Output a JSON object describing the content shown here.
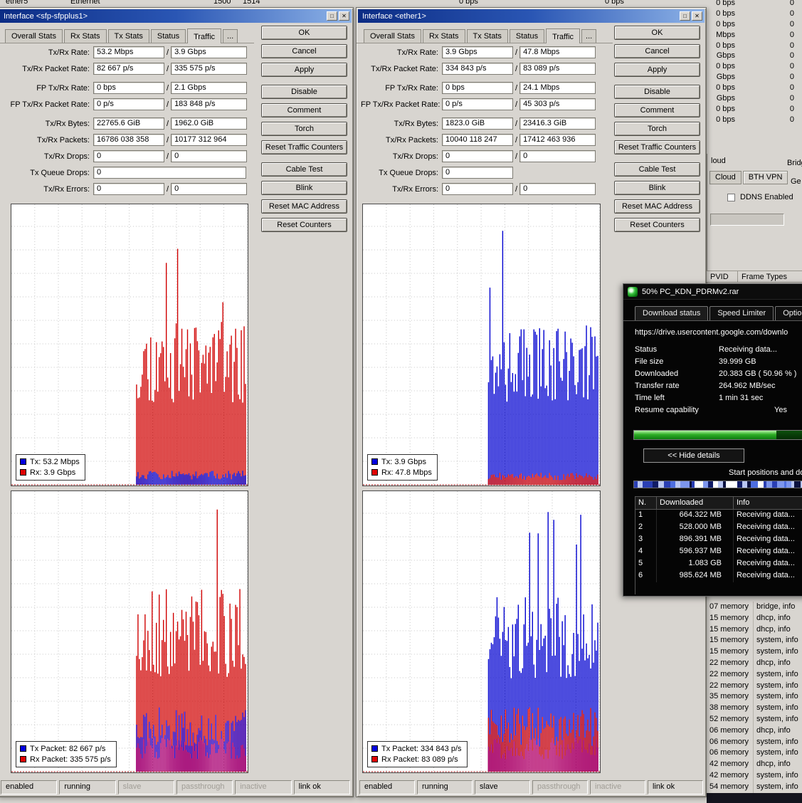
{
  "chrome": {
    "maximize_glyph": "□",
    "close_glyph": "✕"
  },
  "background": {
    "top_row": [
      "ether5",
      "Ethernet",
      "1500",
      "1514",
      "0 bps",
      "0 bps"
    ],
    "right_rates": [
      {
        "rate": "0 bps",
        "count": "0"
      },
      {
        "rate": "0 bps",
        "count": "0"
      },
      {
        "rate": "0 bps",
        "count": "0"
      },
      {
        "rate": "Mbps",
        "count": "0"
      },
      {
        "rate": "0 bps",
        "count": "0"
      },
      {
        "rate": "Gbps",
        "count": "0"
      },
      {
        "rate": "0 bps",
        "count": "0"
      },
      {
        "rate": "Gbps",
        "count": "0"
      },
      {
        "rate": "0 bps",
        "count": "0"
      },
      {
        "rate": "Gbps",
        "count": "0"
      },
      {
        "rate": "0 bps",
        "count": "0"
      },
      {
        "rate": "0 bps",
        "count": "0"
      }
    ],
    "cloud": {
      "title_fragment": "loud",
      "tabs": [
        {
          "label": "Cloud"
        },
        {
          "label": "BTH VPN",
          "active": true
        }
      ],
      "ddns_label": "DDNS Enabled",
      "bridge_fragment": "Bridg",
      "general_fragment": "Ge"
    },
    "port_headers": {
      "pvid": "PVID",
      "frame_types": "Frame Types"
    },
    "log_rows": [
      {
        "t": "07 memory",
        "m": "bridge, info"
      },
      {
        "t": "15 memory",
        "m": "dhcp, info"
      },
      {
        "t": "15 memory",
        "m": "dhcp, info"
      },
      {
        "t": "15 memory",
        "m": "system, info"
      },
      {
        "t": "15 memory",
        "m": "system, info"
      },
      {
        "t": "22 memory",
        "m": "dhcp, info"
      },
      {
        "t": "22 memory",
        "m": "system, info"
      },
      {
        "t": "22 memory",
        "m": "system, info"
      },
      {
        "t": "35 memory",
        "m": "system, info"
      },
      {
        "t": "38 memory",
        "m": "system, info"
      },
      {
        "t": "52 memory",
        "m": "system, info"
      },
      {
        "t": "06 memory",
        "m": "dhcp, info"
      },
      {
        "t": "06 memory",
        "m": "system, info"
      },
      {
        "t": "06 memory",
        "m": "system, info"
      },
      {
        "t": "42 memory",
        "m": "dhcp, info"
      },
      {
        "t": "42 memory",
        "m": "system, info"
      },
      {
        "t": "54 memory",
        "m": "system, info"
      }
    ]
  },
  "iface_left": {
    "title": "Interface <sfp-sfpplus1>",
    "tabs": [
      {
        "label": "Overall Stats"
      },
      {
        "label": "Rx Stats"
      },
      {
        "label": "Tx Stats"
      },
      {
        "label": "Status"
      },
      {
        "label": "Traffic",
        "active": true
      },
      {
        "label": "...",
        "more": true
      }
    ],
    "fields": [
      {
        "label": "Tx/Rx Rate:",
        "v1": "53.2 Mbps",
        "v2": "3.9 Gbps"
      },
      {
        "label": "Tx/Rx Packet Rate:",
        "v1": "82 667 p/s",
        "v2": "335 575 p/s"
      },
      {
        "label": "FP Tx/Rx Rate:",
        "v1": "0 bps",
        "v2": "2.1 Gbps",
        "gap": true
      },
      {
        "label": "FP Tx/Rx Packet Rate:",
        "v1": "0 p/s",
        "v2": "183 848 p/s"
      },
      {
        "label": "Tx/Rx Bytes:",
        "v1": "22765.6 GiB",
        "v2": "1962.0 GiB",
        "gap": true
      },
      {
        "label": "Tx/Rx Packets:",
        "v1": "16786 038 358",
        "v2": "10177 312 964"
      },
      {
        "label": "Tx/Rx Drops:",
        "v1": "0",
        "v2": "0"
      },
      {
        "label": "Tx Queue Drops:",
        "v1": "0",
        "wide": true
      },
      {
        "label": "Tx/Rx Errors:",
        "v1": "0",
        "v2": "0"
      }
    ],
    "buttons": [
      {
        "label": "OK"
      },
      {
        "label": "Cancel"
      },
      {
        "label": "Apply"
      },
      {
        "label": "Disable",
        "gap": true
      },
      {
        "label": "Comment"
      },
      {
        "label": "Torch"
      },
      {
        "label": "Reset Traffic Counters"
      },
      {
        "label": "Cable Test",
        "gap": true
      },
      {
        "label": "Blink"
      },
      {
        "label": "Reset MAC Address"
      },
      {
        "label": "Reset Counters"
      }
    ],
    "graphs": {
      "top": {
        "seed": 11,
        "start": 0.53,
        "base": 0.44,
        "vary": 0.3,
        "spike_p": 0.05,
        "spike_min": 0.6,
        "band": 0.035,
        "primary": "#d00000",
        "secondary": "#0000d0",
        "legend": [
          {
            "color": "#0000e0",
            "label": "Tx: 53.2 Mbps"
          },
          {
            "color": "#e00000",
            "label": "Rx: 3.9 Gbps"
          }
        ]
      },
      "bottom": {
        "seed": 23,
        "start": 0.53,
        "base": 0.5,
        "vary": 0.32,
        "spike_p": 0.05,
        "spike_min": 0.62,
        "band": 0.16,
        "band2": 0.09,
        "band2_color": "#b1006e",
        "primary": "#d00000",
        "secondary": "#2400c8",
        "legend": [
          {
            "color": "#0000e0",
            "label": "Tx Packet: 82 667 p/s"
          },
          {
            "color": "#e00000",
            "label": "Rx Packet: 335 575 p/s"
          }
        ]
      }
    },
    "status": [
      {
        "label": "enabled"
      },
      {
        "label": "running"
      },
      {
        "label": "slave",
        "dim": true
      },
      {
        "label": "passthrough",
        "dim": true
      },
      {
        "label": "inactive",
        "dim": true
      },
      {
        "label": "link ok"
      }
    ]
  },
  "iface_right": {
    "title": "Interface <ether1>",
    "tabs": [
      {
        "label": "Overall Stats"
      },
      {
        "label": "Rx Stats"
      },
      {
        "label": "Tx Stats"
      },
      {
        "label": "Status"
      },
      {
        "label": "Traffic",
        "active": true
      },
      {
        "label": "...",
        "more": true
      }
    ],
    "fields": [
      {
        "label": "Tx/Rx Rate:",
        "v1": "3.9 Gbps",
        "v2": "47.8 Mbps"
      },
      {
        "label": "Tx/Rx Packet Rate:",
        "v1": "334 843 p/s",
        "v2": "83 089 p/s"
      },
      {
        "label": "FP Tx/Rx Rate:",
        "v1": "0 bps",
        "v2": "24.1 Mbps",
        "gap": true
      },
      {
        "label": "FP Tx/Rx Packet Rate:",
        "v1": "0 p/s",
        "v2": "45 303 p/s"
      },
      {
        "label": "Tx/Rx Bytes:",
        "v1": "1823.0 GiB",
        "v2": "23416.3 GiB",
        "gap": true
      },
      {
        "label": "Tx/Rx Packets:",
        "v1": "10040 118 247",
        "v2": "17412 463 936"
      },
      {
        "label": "Tx/Rx Drops:",
        "v1": "0",
        "v2": "0"
      },
      {
        "label": "Tx Queue Drops:",
        "v1": "0"
      },
      {
        "label": "Tx/Rx Errors:",
        "v1": "0",
        "v2": "0"
      }
    ],
    "buttons": [
      {
        "label": "OK"
      },
      {
        "label": "Cancel"
      },
      {
        "label": "Apply"
      },
      {
        "label": "Disable",
        "gap": true
      },
      {
        "label": "Comment"
      },
      {
        "label": "Torch"
      },
      {
        "label": "Reset Traffic Counters"
      },
      {
        "label": "Cable Test",
        "gap": true
      },
      {
        "label": "Blink"
      },
      {
        "label": "Reset MAC Address"
      },
      {
        "label": "Reset Counters"
      }
    ],
    "graphs": {
      "top": {
        "seed": 37,
        "start": 0.53,
        "base": 0.44,
        "vary": 0.28,
        "spike_p": 0.045,
        "spike_min": 0.6,
        "band": 0.03,
        "primary": "#0000d0",
        "secondary": "#d00000",
        "legend": [
          {
            "color": "#0000e0",
            "label": "Tx: 3.9 Gbps"
          },
          {
            "color": "#e00000",
            "label": "Rx: 47.8 Mbps"
          }
        ]
      },
      "bottom": {
        "seed": 51,
        "start": 0.53,
        "base": 0.48,
        "vary": 0.3,
        "spike_p": 0.05,
        "spike_min": 0.62,
        "band": 0.16,
        "band2": 0.09,
        "band2_color": "#b1006e",
        "primary": "#0000d0",
        "secondary": "#d00000",
        "legend": [
          {
            "color": "#0000e0",
            "label": "Tx Packet: 334 843 p/s"
          },
          {
            "color": "#e00000",
            "label": "Rx Packet: 83 089 p/s"
          }
        ]
      }
    },
    "status": [
      {
        "label": "enabled"
      },
      {
        "label": "running"
      },
      {
        "label": "slave"
      },
      {
        "label": "passthrough",
        "dim": true
      },
      {
        "label": "inactive",
        "dim": true
      },
      {
        "label": "link ok"
      }
    ]
  },
  "download": {
    "title": "50% PC_KDN_PDRMv2.rar",
    "tabs": [
      {
        "label": "Download status",
        "active": true
      },
      {
        "label": "Speed Limiter"
      },
      {
        "label": "Options on d"
      }
    ],
    "url": "https://drive.usercontent.google.com/downlo",
    "info_rows": [
      {
        "label": "Status",
        "value": "Receiving data..."
      },
      {
        "label": "File size",
        "value": "39.999 GB"
      },
      {
        "label": "Downloaded",
        "value": "20.383 GB ( 50.96 % )"
      },
      {
        "label": "Transfer rate",
        "value": "264.962 MB/sec"
      },
      {
        "label": "Time left",
        "value": "1 min 31 sec"
      },
      {
        "label": "Resume capability",
        "value": "Yes",
        "push": true
      }
    ],
    "progress_percent": 50.96,
    "hide_button": "<< Hide details",
    "start_positions_label": "Start positions and dow",
    "segment_palette": [
      "#101c66",
      "#2a3fb4",
      "#4e6ee0",
      "#b9c6f2",
      "#ffffff",
      "#0b1240",
      "#7d96ec"
    ],
    "headers": {
      "n": "N.",
      "downloaded": "Downloaded",
      "info": "Info"
    },
    "table_rows": [
      {
        "n": "1",
        "downloaded": "664.322 MB",
        "info": "Receiving data..."
      },
      {
        "n": "2",
        "downloaded": "528.000 MB",
        "info": "Receiving data..."
      },
      {
        "n": "3",
        "downloaded": "896.391 MB",
        "info": "Receiving data..."
      },
      {
        "n": "4",
        "downloaded": "596.937 MB",
        "info": "Receiving data..."
      },
      {
        "n": "5",
        "downloaded": "1.083 GB",
        "info": "Receiving data..."
      },
      {
        "n": "6",
        "downloaded": "985.624 MB",
        "info": "Receiving data..."
      }
    ]
  }
}
